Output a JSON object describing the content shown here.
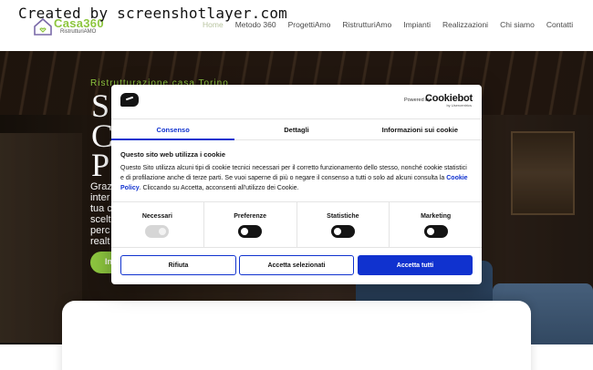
{
  "watermark": "Created by screenshotlayer.com",
  "logo": {
    "name": "Casa360",
    "tagline": "RistrutturiAMO"
  },
  "nav": [
    {
      "label": "Home",
      "active": true
    },
    {
      "label": "Metodo 360",
      "active": false
    },
    {
      "label": "ProgettiAmo",
      "active": false
    },
    {
      "label": "RistrutturiAmo",
      "active": false
    },
    {
      "label": "Impianti",
      "active": false
    },
    {
      "label": "Realizzazioni",
      "active": false
    },
    {
      "label": "Chi siamo",
      "active": false
    },
    {
      "label": "Contatti",
      "active": false
    }
  ],
  "hero": {
    "kicker": "Ristrutturazione casa Torino",
    "line1": "S",
    "line2": "C",
    "line3": "P",
    "paragraph": [
      "Graz",
      "inter",
      "tua c",
      "scelt",
      "perc",
      "realt"
    ],
    "cta_label": "In"
  },
  "cookie_dialog": {
    "powered_by": "Powered by",
    "brand": "Cookiebot",
    "brand_sub": "by Usercentrics",
    "tabs": [
      {
        "label": "Consenso",
        "active": true
      },
      {
        "label": "Dettagli",
        "active": false
      },
      {
        "label": "Informazioni sui cookie",
        "active": false
      }
    ],
    "title": "Questo sito web utilizza i cookie",
    "body_before": "Questo Sito utilizza alcuni tipi di cookie tecnici necessari per il corretto funzionamento dello stesso, nonché cookie statistici e di profilazione anche di terze parti. Se vuoi saperne di più o negare il consenso a tutti o solo ad alcuni consulta la ",
    "body_link": "Cookie Policy",
    "body_after": ". Cliccando su Accetta, acconsenti all'utilizzo dei Cookie.",
    "categories": [
      {
        "label": "Necessari",
        "enabled": true,
        "locked": true
      },
      {
        "label": "Preferenze",
        "enabled": false,
        "locked": false
      },
      {
        "label": "Statistiche",
        "enabled": false,
        "locked": false
      },
      {
        "label": "Marketing",
        "enabled": false,
        "locked": false
      }
    ],
    "buttons": {
      "reject": "Rifiuta",
      "allow_selection": "Accetta selezionati",
      "allow_all": "Accetta tutti"
    },
    "colors": {
      "accent": "#1032cf",
      "text": "#141414"
    }
  },
  "brand_color": "#8dc63f"
}
